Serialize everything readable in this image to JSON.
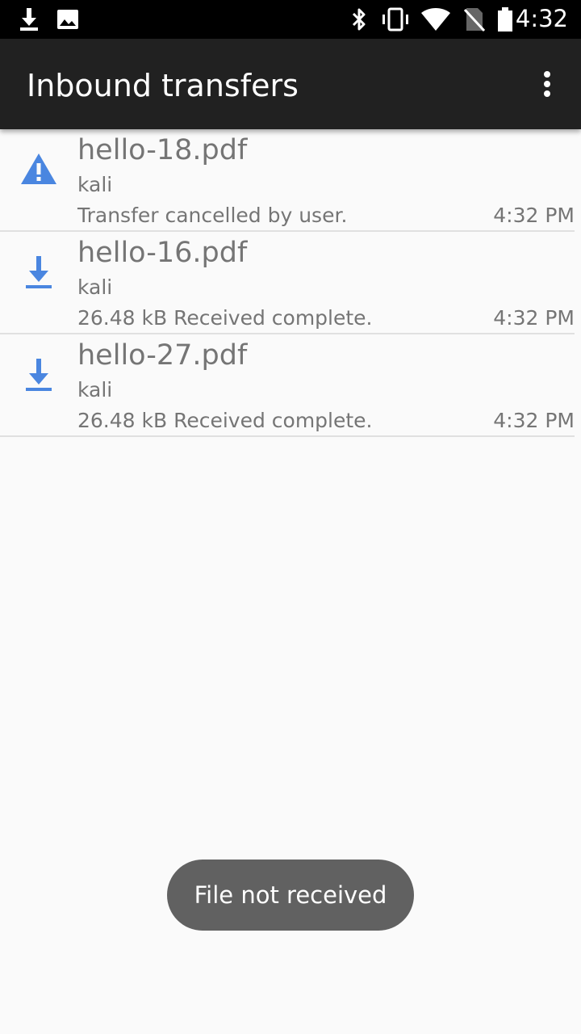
{
  "status_bar": {
    "time": "4:32",
    "icons": [
      "download-icon",
      "image-icon",
      "bluetooth-icon",
      "vibrate-icon",
      "wifi-icon",
      "no-sim-icon",
      "battery-icon"
    ]
  },
  "app_bar": {
    "title": "Inbound transfers",
    "menu_icon": "more-vert-icon"
  },
  "transfers": [
    {
      "filename": "hello-18.pdf",
      "sender": "kali",
      "status": "Transfer cancelled by user.",
      "time": "4:32 PM",
      "icon": "warning-icon"
    },
    {
      "filename": "hello-16.pdf",
      "sender": "kali",
      "status": "26.48 kB Received complete.",
      "time": "4:32 PM",
      "icon": "download-icon"
    },
    {
      "filename": "hello-27.pdf",
      "sender": "kali",
      "status": "26.48 kB Received complete.",
      "time": "4:32 PM",
      "icon": "download-icon"
    }
  ],
  "toast": {
    "message": "File not received"
  },
  "colors": {
    "accent_blue": "#4a86e0",
    "app_bar": "#212121",
    "background": "#fafafa",
    "text_secondary": "#757575",
    "toast": "#616161"
  }
}
